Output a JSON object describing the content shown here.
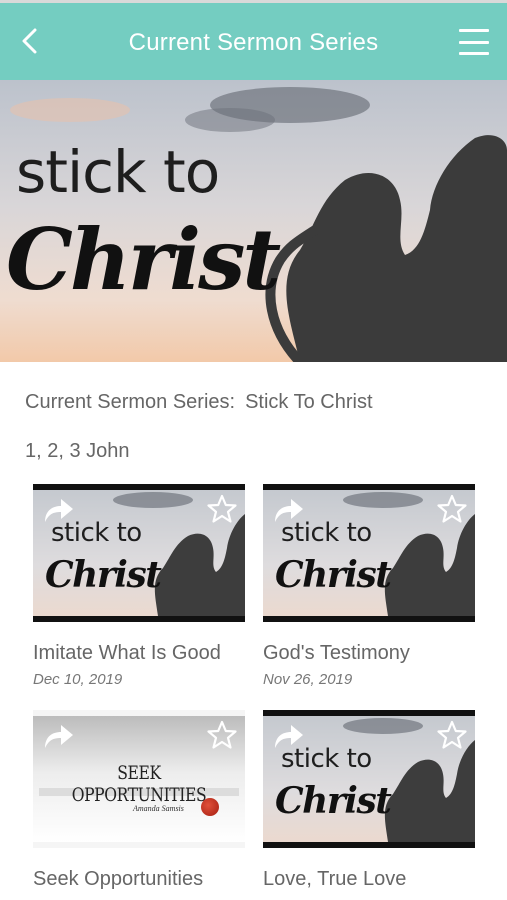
{
  "header": {
    "title": "Current Sermon Series",
    "back_icon": "chevron-left-icon",
    "menu_icon": "hamburger-menu-icon",
    "color": "#74cdc1"
  },
  "hero": {
    "line1": "stick to",
    "line2": "Christ"
  },
  "series": {
    "label": "Current Sermon Series:",
    "name": "Stick To Christ",
    "books": "1, 2, 3 John"
  },
  "sermons": [
    {
      "title": "Imitate What Is Good",
      "date": "Dec 10, 2019",
      "thumb_line1": "stick to",
      "thumb_line2": "Christ"
    },
    {
      "title": "God's Testimony",
      "date": "Nov 26, 2019",
      "thumb_line1": "stick to",
      "thumb_line2": "Christ"
    },
    {
      "title": "Seek Opportunities",
      "date": "",
      "thumb_text": "SEEK OPPORTUNITIES",
      "thumb_sub": "Amanda Samsis"
    },
    {
      "title": "Love, True Love",
      "date": "",
      "thumb_line1": "stick to",
      "thumb_line2": "Christ"
    }
  ],
  "icons": {
    "share": "share-arrow-icon",
    "favorite": "star-outline-icon"
  }
}
